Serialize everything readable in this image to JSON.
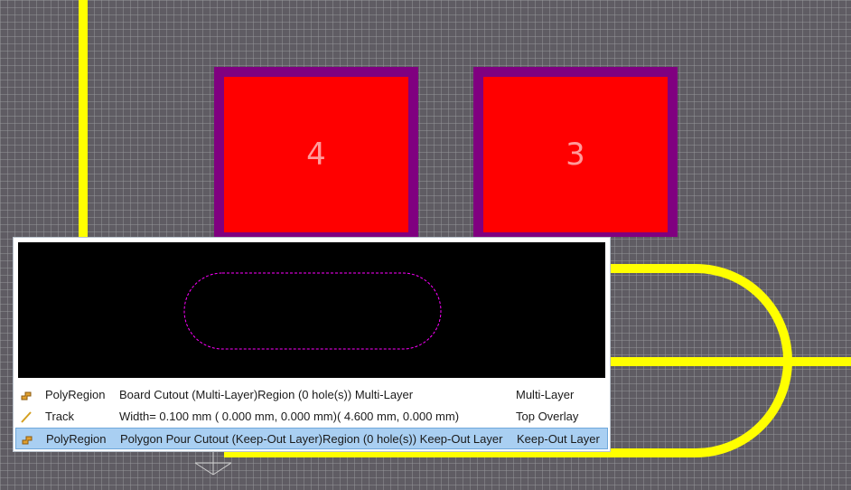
{
  "pads": [
    {
      "label": "4"
    },
    {
      "label": "3"
    }
  ],
  "colors": {
    "background": "#5f5c63",
    "track": "#ffff00",
    "pad": "#ff0000",
    "solder_mask": "#800080",
    "cutout_outline": "#ff00ff",
    "selection": "#a9cff2"
  },
  "objects": [
    {
      "icon": "polyregion-icon",
      "type": "PolyRegion",
      "description": "Board Cutout (Multi-Layer)Region (0 hole(s)) Multi-Layer",
      "layer": "Multi-Layer",
      "selected": false
    },
    {
      "icon": "track-icon",
      "type": "Track",
      "description": "Width=  0.100 mm (  0.000 mm,  0.000 mm)(  4.600 mm,  0.000 mm)",
      "layer": "Top Overlay",
      "selected": false
    },
    {
      "icon": "polyregion-icon",
      "type": "PolyRegion",
      "description": "Polygon Pour Cutout (Keep-Out Layer)Region (0 hole(s)) Keep-Out Layer",
      "layer": "Keep-Out Layer",
      "selected": true
    }
  ]
}
